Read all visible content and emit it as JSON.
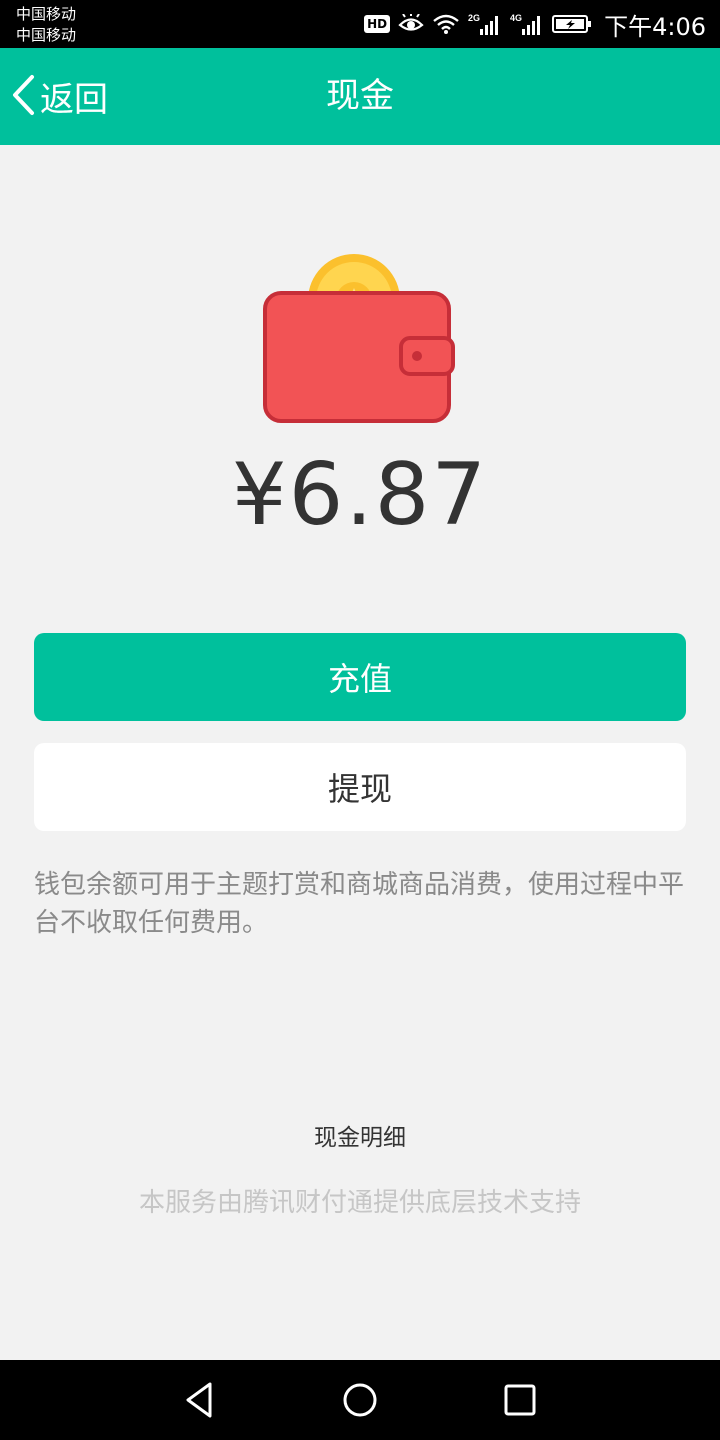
{
  "status_bar": {
    "carrier_1": "中国移动",
    "carrier_2": "中国移动",
    "hd_label": "HD",
    "network_1": "2G",
    "network_2": "4G",
    "time": "下午4:06",
    "icons": [
      "hd-icon",
      "eye-icon",
      "wifi-icon",
      "signal-2g-icon",
      "signal-4g-icon",
      "battery-charging-icon"
    ]
  },
  "app_bar": {
    "back_label": "返回",
    "title": "现金",
    "color": "#00c09c"
  },
  "wallet": {
    "icon": "wallet-coin-icon",
    "balance": "¥6.87"
  },
  "actions": {
    "recharge_label": "充值",
    "withdraw_label": "提现"
  },
  "info_text": "钱包余额可用于主题打赏和商城商品消费，使用过程中平台不收取任何费用。",
  "links": {
    "cash_detail_label": "现金明细"
  },
  "footer_note": "本服务由腾讯财付通提供底层技术支持",
  "nav_bar": {
    "icons": [
      "back-triangle-icon",
      "home-circle-icon",
      "recent-square-icon"
    ]
  },
  "colors": {
    "accent": "#00c09c",
    "background": "#f2f2f2",
    "wallet_red": "#f25355",
    "coin_gold": "#fbc02d"
  }
}
